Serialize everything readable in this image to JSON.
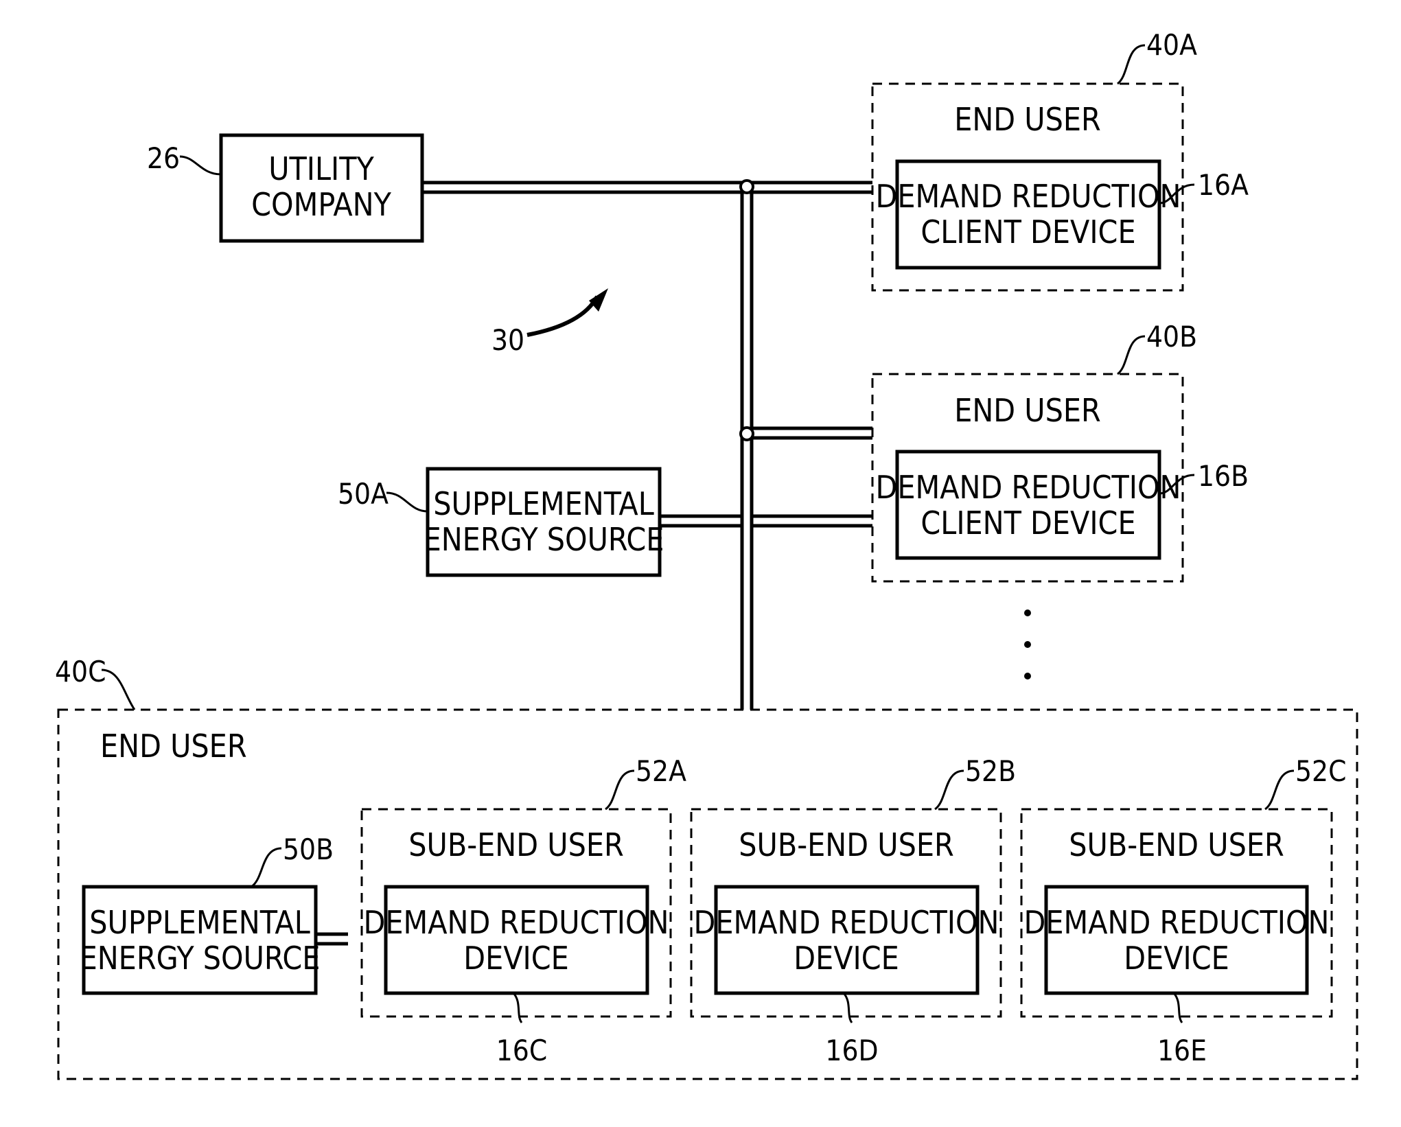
{
  "figure": {
    "system_ref": "30",
    "utility": {
      "ref": "26",
      "lines": [
        "UTILITY",
        "COMPANY"
      ]
    },
    "end_users": [
      {
        "ref": "40A",
        "title": "END USER",
        "device": {
          "ref": "16A",
          "lines": [
            "DEMAND REDUCTION",
            "CLIENT DEVICE"
          ]
        }
      },
      {
        "ref": "40B",
        "title": "END USER",
        "device": {
          "ref": "16B",
          "lines": [
            "DEMAND REDUCTION",
            "CLIENT DEVICE"
          ]
        }
      }
    ],
    "supplemental_a": {
      "ref": "50A",
      "lines": [
        "SUPPLEMENTAL",
        "ENERGY SOURCE"
      ]
    },
    "end_user_c": {
      "ref": "40C",
      "title": "END USER",
      "supplemental": {
        "ref": "50B",
        "lines": [
          "SUPPLEMENTAL",
          "ENERGY SOURCE"
        ]
      },
      "sub_end_users": [
        {
          "ref": "52A",
          "title": "SUB-END USER",
          "device": {
            "ref": "16C",
            "lines": [
              "DEMAND REDUCTION",
              "DEVICE"
            ]
          }
        },
        {
          "ref": "52B",
          "title": "SUB-END USER",
          "device": {
            "ref": "16D",
            "lines": [
              "DEMAND REDUCTION",
              "DEVICE"
            ]
          }
        },
        {
          "ref": "52C",
          "title": "SUB-END USER",
          "device": {
            "ref": "16E",
            "lines": [
              "DEMAND REDUCTION",
              "DEVICE"
            ]
          }
        }
      ]
    }
  }
}
